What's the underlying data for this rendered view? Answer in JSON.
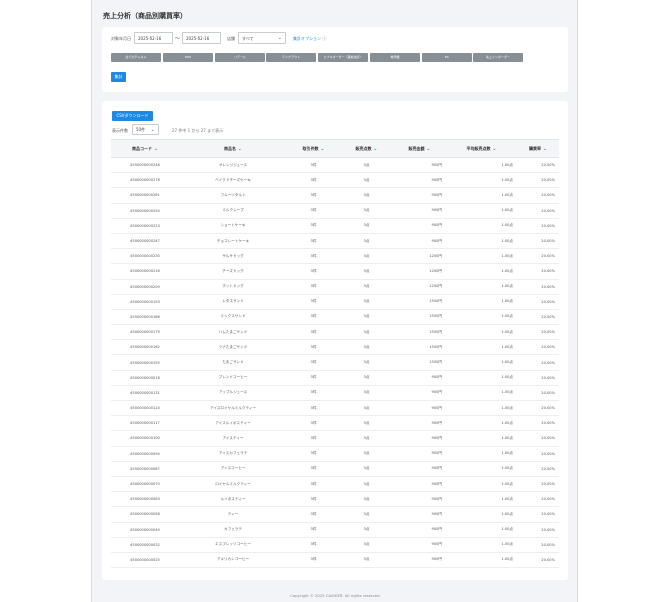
{
  "page": {
    "title": "売上分析（商品別購買率）",
    "footer": "Copyright © 2025 CASHIER. All rights reserved."
  },
  "filters": {
    "period_label": "対象年月日",
    "date_from": "2025-02-16",
    "date_sep": "〜",
    "date_to": "2025-02-16",
    "store_label": "店舗",
    "store_value": "すべて",
    "options_link": "集計オプション",
    "channels": [
      "全てのチャネル",
      "POS",
      "リテール",
      "テイクアウト",
      "ミブキオーダー（事前決済）",
      "券売機",
      "EC",
      "先上インボーダー"
    ],
    "aggregate_label": "集計"
  },
  "results": {
    "csv_label": "CSVダウンロード",
    "per_page_label": "表示件数",
    "per_page_value": "50件",
    "count_info": "27 件中 1 から 27 まで表示",
    "columns": [
      "商品コード",
      "商品名",
      "取引件数",
      "販売点数",
      "販売金額",
      "平均販売点数",
      "購買率"
    ],
    "rows": [
      [
        "4500000000248",
        "オレンジジュース",
        "3件",
        "3点",
        "900円",
        "1.00点",
        "20.00%"
      ],
      [
        "4500000000278",
        "ベイクドチーズケーキ",
        "3件",
        "3点",
        "900円",
        "1.00点",
        "20.00%"
      ],
      [
        "4500000000261",
        "フルーツタルト",
        "3件",
        "3点",
        "900円",
        "1.00点",
        "20.00%"
      ],
      [
        "4500000000254",
        "ミルクレープ",
        "3件",
        "3点",
        "900円",
        "1.00点",
        "20.00%"
      ],
      [
        "4500000000223",
        "ショートケーキ",
        "3件",
        "3点",
        "900円",
        "1.00点",
        "20.00%"
      ],
      [
        "4500000000247",
        "チョコレートケーキ",
        "3件",
        "3点",
        "900円",
        "1.00点",
        "20.00%"
      ],
      [
        "4500000000230",
        "サルサドッグ",
        "3件",
        "3点",
        "1200円",
        "1.00点",
        "20.00%"
      ],
      [
        "4500000000216",
        "チーズドッグ",
        "3件",
        "3点",
        "1200円",
        "1.00点",
        "20.00%"
      ],
      [
        "4500000000209",
        "ホットドッグ",
        "3件",
        "3点",
        "1200円",
        "1.00点",
        "20.00%"
      ],
      [
        "4500000000193",
        "レタスサンド",
        "3件",
        "3点",
        "1500円",
        "1.00点",
        "20.00%"
      ],
      [
        "4500000000186",
        "ミックスサンド",
        "3件",
        "3点",
        "1500円",
        "1.00点",
        "20.00%"
      ],
      [
        "4500000000179",
        "ハムたまごサンド",
        "3件",
        "3点",
        "1500円",
        "1.00点",
        "20.00%"
      ],
      [
        "4500000000162",
        "ツナたまごサンド",
        "3件",
        "3点",
        "1500円",
        "1.00点",
        "20.00%"
      ],
      [
        "4500000000155",
        "たまごサンド",
        "3件",
        "3点",
        "1500円",
        "1.00点",
        "20.00%"
      ],
      [
        "4500000000018",
        "ブレンドコーヒー",
        "3件",
        "3点",
        "900円",
        "1.00点",
        "20.00%"
      ],
      [
        "4500000000131",
        "アップルジュース",
        "3件",
        "3点",
        "900円",
        "1.00点",
        "20.00%"
      ],
      [
        "4500000000124",
        "アイスロイヤルミルクティー",
        "3件",
        "3点",
        "900円",
        "1.00点",
        "20.00%"
      ],
      [
        "4500000000117",
        "アイスルイボスティー",
        "3件",
        "3点",
        "900円",
        "1.00点",
        "20.00%"
      ],
      [
        "4500000000100",
        "アイスティー",
        "3件",
        "3点",
        "900円",
        "1.00点",
        "20.00%"
      ],
      [
        "4500000000094",
        "アイスカフェラテ",
        "3件",
        "3点",
        "900円",
        "1.00点",
        "20.00%"
      ],
      [
        "4500000000087",
        "アイスコーヒー",
        "3件",
        "3点",
        "900円",
        "1.00点",
        "20.00%"
      ],
      [
        "4500000000070",
        "ロイヤルミルクティー",
        "3件",
        "3点",
        "900円",
        "1.00点",
        "20.00%"
      ],
      [
        "4500000000063",
        "ルイボスティー",
        "3件",
        "3点",
        "900円",
        "1.00点",
        "20.00%"
      ],
      [
        "4500000000056",
        "ティー",
        "3件",
        "3点",
        "900円",
        "1.00点",
        "20.00%"
      ],
      [
        "4500000000049",
        "カフェラテ",
        "3件",
        "3点",
        "900円",
        "1.00点",
        "20.00%"
      ],
      [
        "4500000000032",
        "エスプレッソコーヒー",
        "3件",
        "3点",
        "900円",
        "1.00点",
        "20.00%"
      ],
      [
        "4500000000025",
        "アメリカンコーヒー",
        "3件",
        "3点",
        "900円",
        "1.00点",
        "20.00%"
      ]
    ]
  }
}
